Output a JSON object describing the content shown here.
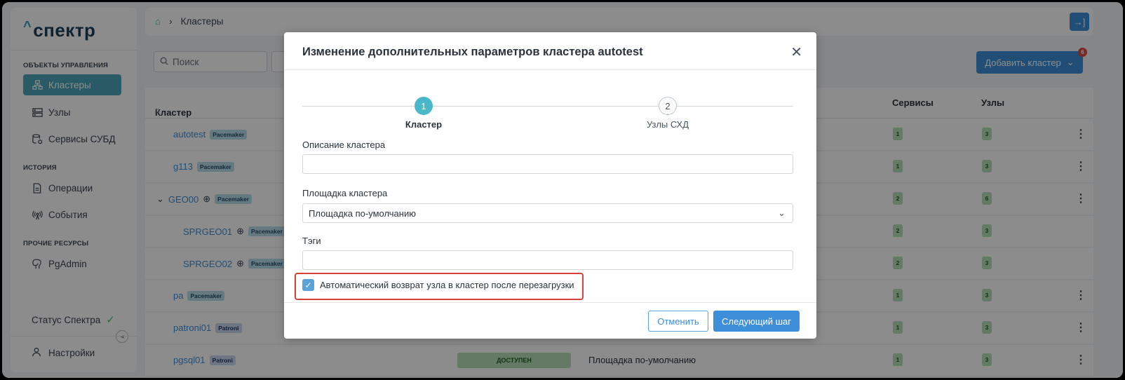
{
  "sidebar": {
    "logo": "спектр",
    "sections": {
      "management": "ОБЪЕКТЫ УПРАВЛЕНИЯ",
      "history": "ИСТОРИЯ",
      "other": "ПРОЧИЕ РЕСУРСЫ"
    },
    "items": {
      "clusters": "Кластеры",
      "nodes": "Узлы",
      "dbms_services": "Сервисы СУБД",
      "operations": "Операции",
      "events": "События",
      "pgadmin": "PgAdmin"
    },
    "status": "Статус Спектра",
    "settings": "Настройки"
  },
  "topbar": {
    "breadcrumb": "Кластеры"
  },
  "toolbar": {
    "search_placeholder": "Поиск",
    "add_cluster": "Добавить кластер",
    "notifications_count": "6"
  },
  "table": {
    "headers": {
      "cluster": "Кластер",
      "services": "Сервисы",
      "nodes": "Узлы"
    },
    "rows": [
      {
        "name": "autotest",
        "tag": "Pacemaker",
        "services": "1",
        "nodes": "3"
      },
      {
        "name": "g113",
        "tag": "Pacemaker",
        "services": "1",
        "nodes": "3"
      },
      {
        "name": "GEO00",
        "tag": "Pacemaker",
        "services": "2",
        "nodes": "6"
      },
      {
        "name": "SPRGEO01",
        "tag": "Pacemaker",
        "services": "2",
        "nodes": "3"
      },
      {
        "name": "SPRGEO02",
        "tag": "Pacemaker",
        "services": "2",
        "nodes": "3"
      },
      {
        "name": "pa",
        "tag": "Pacemaker",
        "services": "1",
        "nodes": "3"
      },
      {
        "name": "patroni01",
        "tag": "Patroni",
        "services": "1",
        "nodes": "3"
      },
      {
        "name": "pgsql01",
        "tag": "Patroni",
        "services": "1",
        "nodes": "3",
        "status": "ДОСТУПЕН",
        "site": "Площадка по-умолчанию"
      }
    ]
  },
  "modal": {
    "title": "Изменение дополнительных параметров кластера autotest",
    "steps": [
      {
        "number": "1",
        "label": "Кластер"
      },
      {
        "number": "2",
        "label": "Узлы СХД"
      }
    ],
    "fields": {
      "description_label": "Описание кластера",
      "description_value": "",
      "site_label": "Площадка кластера",
      "site_value": "Площадка по-умолчанию",
      "tags_label": "Тэги",
      "tags_value": ""
    },
    "checkbox_label": "Автоматический возврат узла в кластер после перезагрузки",
    "checkbox_checked": true,
    "cancel": "Отменить",
    "next": "Следующий шаг"
  }
}
